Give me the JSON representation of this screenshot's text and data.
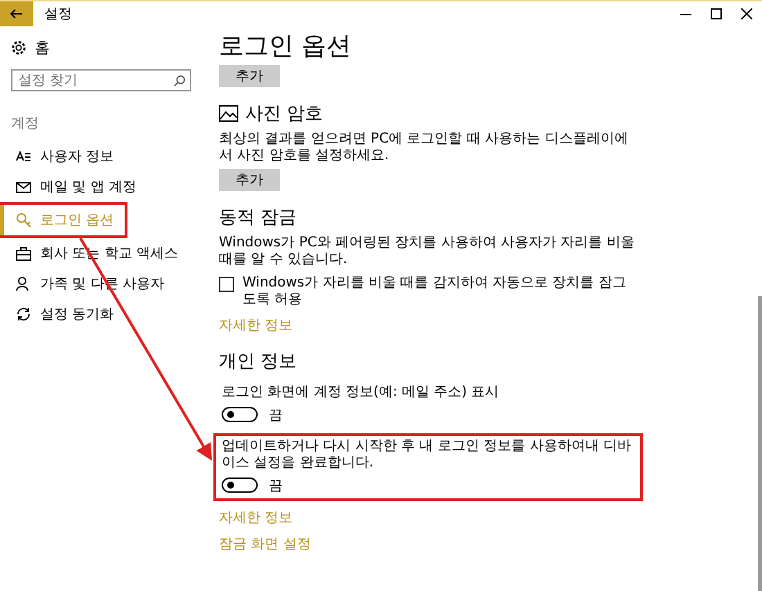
{
  "window": {
    "title": "설정"
  },
  "sidebar": {
    "home": "홈",
    "search": {
      "placeholder": "설정 찾기"
    },
    "section": "계정",
    "items": [
      {
        "label": "사용자 정보",
        "selected": false,
        "highlighted": false
      },
      {
        "label": "메일 및 앱 계정",
        "selected": false,
        "highlighted": false
      },
      {
        "label": "로그인 옵션",
        "selected": true,
        "highlighted": true
      },
      {
        "label": "회사 또는 학교 액세스",
        "selected": false,
        "highlighted": false
      },
      {
        "label": "가족 및 다른 사용자",
        "selected": false,
        "highlighted": false
      },
      {
        "label": "설정 동기화",
        "selected": false,
        "highlighted": false
      }
    ]
  },
  "content": {
    "title": "로그인 옵션",
    "top_button": "추가",
    "sections": [
      {
        "kind": "picture_password",
        "heading": "사진 암호",
        "description": "최상의 결과를 얻으려면 PC에 로그인할 때 사용하는 디스플레이에서 사진 암호를 설정하세요.",
        "button": "추가"
      },
      {
        "kind": "dynamic_lock",
        "heading": "동적 잠금",
        "description": "Windows가 PC와 페어링된 장치를 사용하여 사용자가 자리를 비울 때를 알 수 있습니다.",
        "checkbox": {
          "label": "Windows가 자리를 비울 때를 감지하여 자동으로 장치를 잠그도록 허용",
          "checked": false
        },
        "link": "자세한 정보"
      },
      {
        "kind": "privacy",
        "heading": "개인 정보",
        "settings": [
          {
            "label": "로그인 화면에 계정 정보(예: 메일 주소) 표시",
            "on": false,
            "state": "끔",
            "highlighted": false
          },
          {
            "label": "업데이트하거나 다시 시작한 후 내 로그인 정보를 사용하여내 디바이스 설정을 완료합니다.",
            "on": false,
            "state": "끔",
            "highlighted": true
          }
        ],
        "links": [
          "자세한 정보",
          "잠금 화면 설정"
        ]
      }
    ]
  }
}
